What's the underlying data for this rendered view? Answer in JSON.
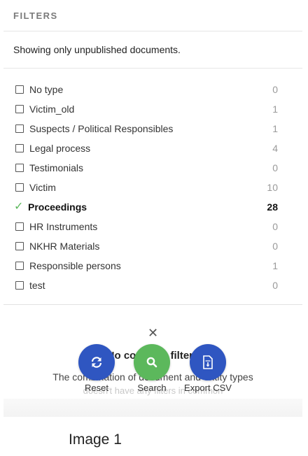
{
  "header": {
    "title": "FILTERS"
  },
  "notice": "Showing only unpublished documents.",
  "filters": [
    {
      "label": "No type",
      "count": "0",
      "selected": false
    },
    {
      "label": "Victim_old",
      "count": "1",
      "selected": false
    },
    {
      "label": "Suspects / Political Responsibles",
      "count": "1",
      "selected": false
    },
    {
      "label": "Legal process",
      "count": "4",
      "selected": false
    },
    {
      "label": "Testimonials",
      "count": "0",
      "selected": false
    },
    {
      "label": "Victim",
      "count": "10",
      "selected": false
    },
    {
      "label": "Proceedings",
      "count": "28",
      "selected": true
    },
    {
      "label": "HR Instruments",
      "count": "0",
      "selected": false
    },
    {
      "label": "NKHR Materials",
      "count": "0",
      "selected": false
    },
    {
      "label": "Responsible persons",
      "count": "1",
      "selected": false
    },
    {
      "label": "test",
      "count": "0",
      "selected": false
    }
  ],
  "background": {
    "title": "No common filters",
    "description": "The combination of document and entity types",
    "description2": "doesn't have any filters in common"
  },
  "actions": {
    "reset": "Reset",
    "search": "Search",
    "export": "Export CSV"
  },
  "colors": {
    "reset": "#2f56c1",
    "search": "#5cb85c",
    "export": "#2f56c1",
    "checkmark": "#5cb85c"
  },
  "caption": "Image 1"
}
